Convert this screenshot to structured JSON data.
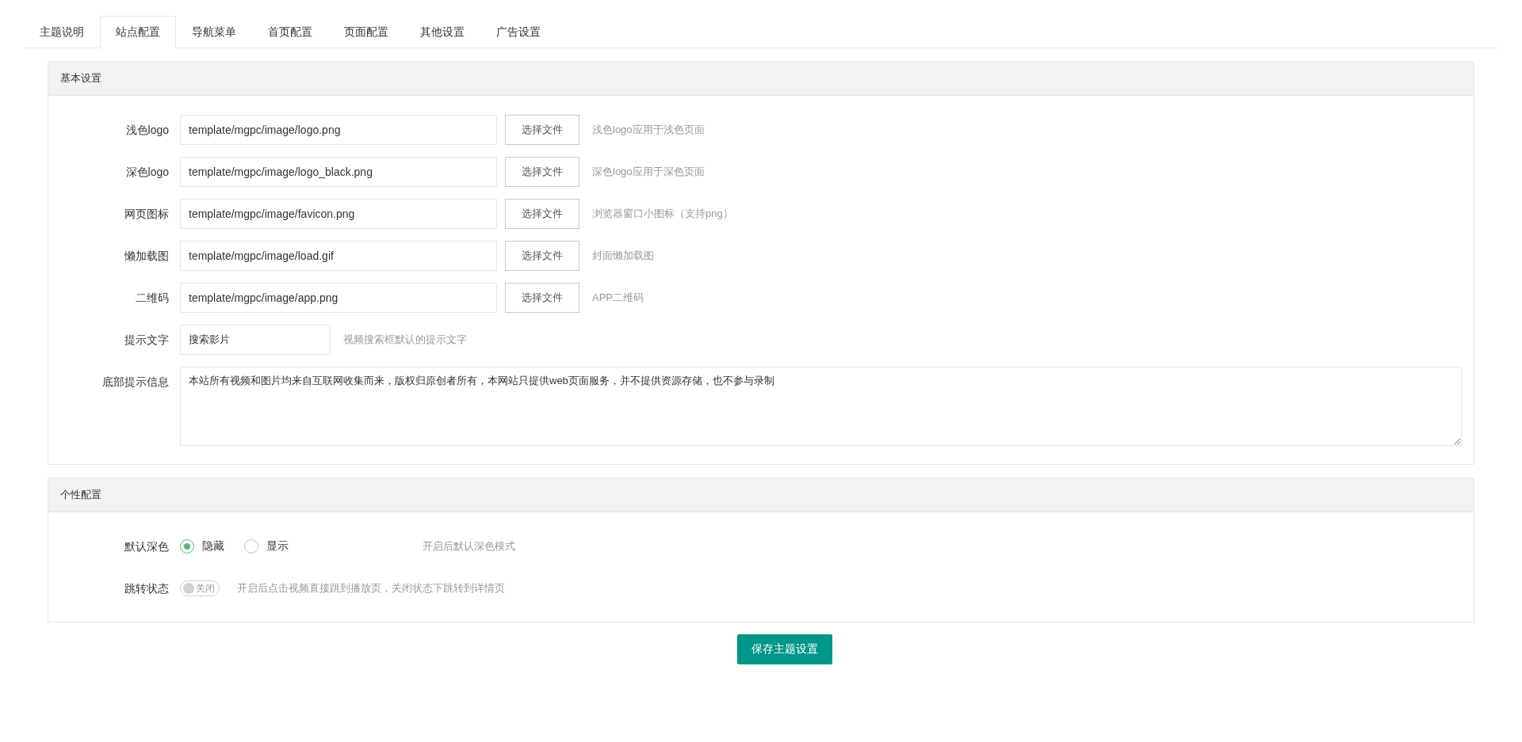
{
  "tabs": [
    {
      "label": "主题说明",
      "selected": false
    },
    {
      "label": "站点配置",
      "selected": true
    },
    {
      "label": "导航菜单",
      "selected": false
    },
    {
      "label": "首页配置",
      "selected": false
    },
    {
      "label": "页面配置",
      "selected": false
    },
    {
      "label": "其他设置",
      "selected": false
    },
    {
      "label": "广告设置",
      "selected": false
    }
  ],
  "panels": [
    {
      "title": "基本设置",
      "fields": [
        {
          "kind": "file",
          "label": "浅色logo",
          "value": "template/mgpc/image/logo.png",
          "button": "选择文件",
          "hint": "浅色logo应用于浅色页面"
        },
        {
          "kind": "file",
          "label": "深色logo",
          "value": "template/mgpc/image/logo_black.png",
          "button": "选择文件",
          "hint": "深色logo应用于深色页面"
        },
        {
          "kind": "file",
          "label": "网页图标",
          "value": "template/mgpc/image/favicon.png",
          "button": "选择文件",
          "hint": "浏览器窗口小图标（支持png）"
        },
        {
          "kind": "file",
          "label": "懒加载图",
          "value": "template/mgpc/image/load.gif",
          "button": "选择文件",
          "hint": "封面懒加载图"
        },
        {
          "kind": "file",
          "label": "二维码",
          "value": "template/mgpc/image/app.png",
          "button": "选择文件",
          "hint": "APP二维码"
        },
        {
          "kind": "short",
          "label": "提示文字",
          "value": "搜索影片",
          "hint": "视频搜索框默认的提示文字"
        },
        {
          "kind": "textarea",
          "label": "底部提示信息",
          "value": "本站所有视频和图片均来自互联网收集而来，版权归原创者所有，本网站只提供web页面服务，并不提供资源存储，也不参与录制"
        }
      ]
    },
    {
      "title": "个性配置",
      "fields": [
        {
          "kind": "radio",
          "label": "默认深色",
          "options": [
            {
              "label": "隐藏",
              "selected": true
            },
            {
              "label": "显示",
              "selected": false
            }
          ],
          "hint": "开启后默认深色模式"
        },
        {
          "kind": "switch",
          "label": "跳转状态",
          "on": false,
          "text": "关闭",
          "hint": "开启后点击视频直接跳到播放页，关闭状态下跳转到详情页"
        }
      ]
    }
  ],
  "save_button": "保存主题设置"
}
